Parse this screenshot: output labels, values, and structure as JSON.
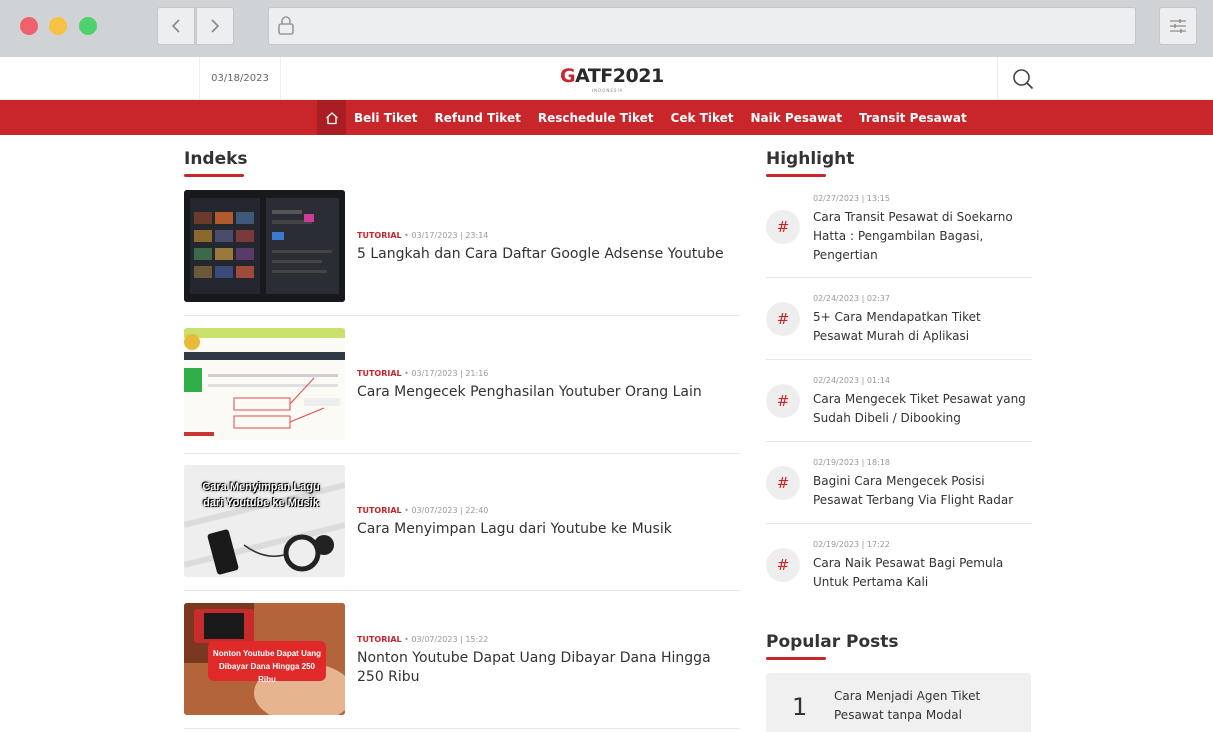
{
  "header": {
    "date": "03/18/2023",
    "logo_text": "ATF2021",
    "logo_g": "G",
    "logo_sub": "INDONESIA"
  },
  "nav": {
    "items": [
      {
        "label": "Beli Tiket"
      },
      {
        "label": "Refund Tiket"
      },
      {
        "label": "Reschedule Tiket"
      },
      {
        "label": "Cek Tiket"
      },
      {
        "label": "Naik Pesawat"
      },
      {
        "label": "Transit Pesawat"
      }
    ]
  },
  "indeks": {
    "title": "Indeks",
    "articles": [
      {
        "category": "TUTORIAL",
        "datetime": "03/17/2023 | 23:14",
        "title": "5 Langkah dan Cara Daftar Google Adsense Youtube"
      },
      {
        "category": "TUTORIAL",
        "datetime": "03/17/2023 | 21:16",
        "title": "Cara Mengecek Penghasilan Youtuber Orang Lain"
      },
      {
        "category": "TUTORIAL",
        "datetime": "03/07/2023 | 22:40",
        "title": "Cara Menyimpan Lagu dari Youtube ke Musik",
        "thumb_text": "Cara Menyimpan Lagu dari Youtube ke Musik"
      },
      {
        "category": "TUTORIAL",
        "datetime": "03/07/2023 | 15:22",
        "title": "Nonton Youtube Dapat Uang Dibayar Dana Hingga 250 Ribu",
        "thumb_text": "Nonton Youtube Dapat Uang Dibayar Dana Hingga 250 Ribu"
      }
    ]
  },
  "highlight": {
    "title": "Highlight",
    "items": [
      {
        "datetime": "02/27/2023 | 13:15",
        "title": "Cara Transit Pesawat di Soekarno Hatta : Pengambilan Bagasi, Pengertian"
      },
      {
        "datetime": "02/24/2023 | 02:37",
        "title": "5+ Cara Mendapatkan Tiket Pesawat Murah di Aplikasi"
      },
      {
        "datetime": "02/24/2023 | 01:14",
        "title": "Cara Mengecek Tiket Pesawat yang Sudah Dibeli / Dibooking"
      },
      {
        "datetime": "02/19/2023 | 18:18",
        "title": "Bagini Cara Mengecek Posisi Pesawat Terbang Via Flight Radar"
      },
      {
        "datetime": "02/19/2023 | 17:22",
        "title": "Cara Naik Pesawat Bagi Pemula Untuk Pertama Kali"
      }
    ]
  },
  "popular": {
    "title": "Popular Posts",
    "items": [
      {
        "rank": "1",
        "title": "Cara Menjadi Agen Tiket Pesawat tanpa Modal"
      }
    ]
  },
  "colors": {
    "brand_red": "#c8262b",
    "chrome": "#cfd3d6"
  }
}
